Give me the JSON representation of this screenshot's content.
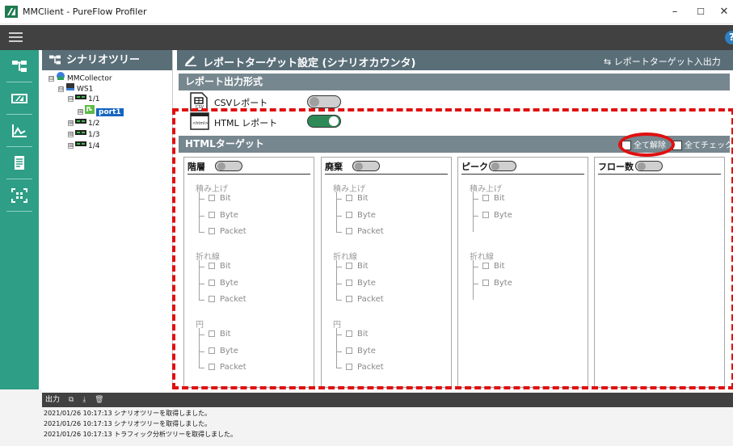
{
  "window": {
    "title": "MMClient - PureFlow Profiler",
    "minimize": "–",
    "maximize": "☐",
    "close": "✕"
  },
  "menu": {
    "help_symbol": "?"
  },
  "rail": {
    "items": [
      "scenario-tree-icon",
      "network-icon",
      "graph-icon",
      "report-icon",
      "capture-icon"
    ],
    "accent": "#2e9e86"
  },
  "tree": {
    "header": "シナリオツリー",
    "nodes": [
      {
        "label": "MMCollector",
        "toggle": "⊟"
      },
      {
        "label": "WS1",
        "toggle": "⊟"
      },
      {
        "label": "1/1",
        "toggle": "⊟"
      },
      {
        "label": "port1",
        "toggle": "⊞"
      },
      {
        "label": "1/2",
        "toggle": "⊞"
      },
      {
        "label": "1/3",
        "toggle": "⊞"
      },
      {
        "label": "1/4",
        "toggle": "⊞"
      }
    ]
  },
  "main": {
    "title": "レポートターゲット設定 (シナリオカウンタ)",
    "io_button": "レポートターゲット入出力",
    "format_section": "レポート出力形式",
    "formats": [
      {
        "label": "CSVレポート",
        "icon_text": "CSV",
        "enabled": false
      },
      {
        "label": "HTML レポート",
        "icon_text": "<html>",
        "enabled": true
      }
    ],
    "target_section": "HTMLターゲット",
    "clear_all": "全て解除",
    "check_all": "全てチェック",
    "cards": [
      {
        "title": "階層",
        "groups": [
          {
            "name": "積み上げ",
            "options": [
              "Bit",
              "Byte",
              "Packet"
            ]
          },
          {
            "name": "折れ線",
            "options": [
              "Bit",
              "Byte",
              "Packet"
            ]
          },
          {
            "name": "円",
            "options": [
              "Bit",
              "Byte",
              "Packet"
            ]
          }
        ]
      },
      {
        "title": "廃棄",
        "groups": [
          {
            "name": "積み上げ",
            "options": [
              "Bit",
              "Byte",
              "Packet"
            ]
          },
          {
            "name": "折れ線",
            "options": [
              "Bit",
              "Byte",
              "Packet"
            ]
          },
          {
            "name": "円",
            "options": [
              "Bit",
              "Byte",
              "Packet"
            ]
          }
        ]
      },
      {
        "title": "ピーク",
        "groups": [
          {
            "name": "積み上げ",
            "options": [
              "Bit",
              "Byte"
            ]
          },
          {
            "name": "折れ線",
            "options": [
              "Bit",
              "Byte"
            ]
          }
        ]
      },
      {
        "title": "フロー数",
        "groups": []
      }
    ]
  },
  "output": {
    "label": "出力",
    "logs": [
      "2021/01/26 10:17:13 シナリオツリーを取得しました。",
      "2021/01/26 10:17:13 シナリオツリーを取得しました。",
      "2021/01/26 10:17:13 トラフィック分析ツリーを取得しました。"
    ]
  }
}
